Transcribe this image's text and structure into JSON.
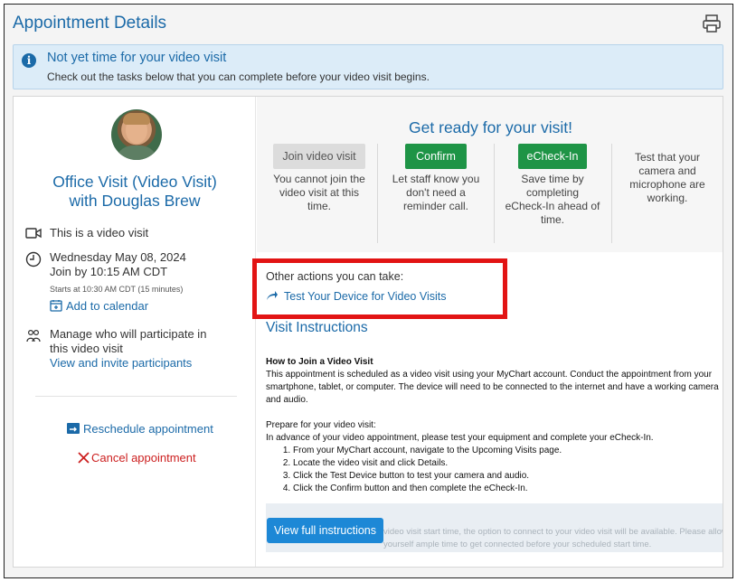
{
  "header": {
    "title": "Appointment Details"
  },
  "banner": {
    "title": "Not yet time for your video visit",
    "subtitle": "Check out the tasks below that you can complete before your video visit begins."
  },
  "visit": {
    "name_line1": "Office Visit (Video Visit)",
    "name_line2": "with Douglas Brew",
    "video_note": "This is a video visit",
    "date": "Wednesday May 08, 2024",
    "join_by": "Join by 10:15 AM CDT",
    "starts_at": "Starts at 10:30 AM CDT (15 minutes)",
    "add_calendar": "Add to calendar",
    "participants_line1": "Manage who will participate in",
    "participants_line2": "this video visit",
    "participants_link": "View and invite participants",
    "reschedule": "Reschedule appointment",
    "cancel": "Cancel appointment"
  },
  "ready": {
    "title": "Get ready for your visit!",
    "join": {
      "label": "Join video visit",
      "desc": [
        "You cannot join the",
        "video visit at this",
        "time."
      ]
    },
    "confirm": {
      "label": "Confirm",
      "desc": [
        "Let staff know you",
        "don't need a",
        "reminder call."
      ]
    },
    "echeckin": {
      "label": "eCheck-In",
      "desc": [
        "Save time by",
        "completing",
        "eCheck-In ahead of",
        "time."
      ]
    },
    "test": {
      "desc": [
        "Test that your",
        "camera and",
        "microphone are",
        "working."
      ]
    }
  },
  "other_actions": {
    "label": "Other actions you can take:",
    "test_link": "Test Your Device for Video Visits"
  },
  "instructions": {
    "title": "Visit Instructions",
    "heading": "How to Join a Video Visit",
    "para1": "This appointment is scheduled as a video visit using your MyChart account. Conduct the appointment from your smartphone, tablet, or computer. The device will need to be connected to the internet and have a working camera and audio.",
    "prepare": "Prepare for your video visit:",
    "advance": "In advance of your video appointment, please test your equipment and complete your eCheck-In.",
    "steps": [
      "From your MyChart account, navigate to the Upcoming Visits page.",
      "Locate the video visit and click Details.",
      "Click the Test Device button to test your camera and audio.",
      "Click the Confirm button and then complete the eCheck-In."
    ],
    "faded": "video visit start time, the option to connect to your video visit will be available. Please allow yourself ample time to get connected before your scheduled start time.",
    "view_full": "View full instructions"
  },
  "colors": {
    "accent": "#1b6aa8",
    "green": "#1e9446",
    "cancel": "#cc1f1f",
    "highlight": "#e21414"
  }
}
